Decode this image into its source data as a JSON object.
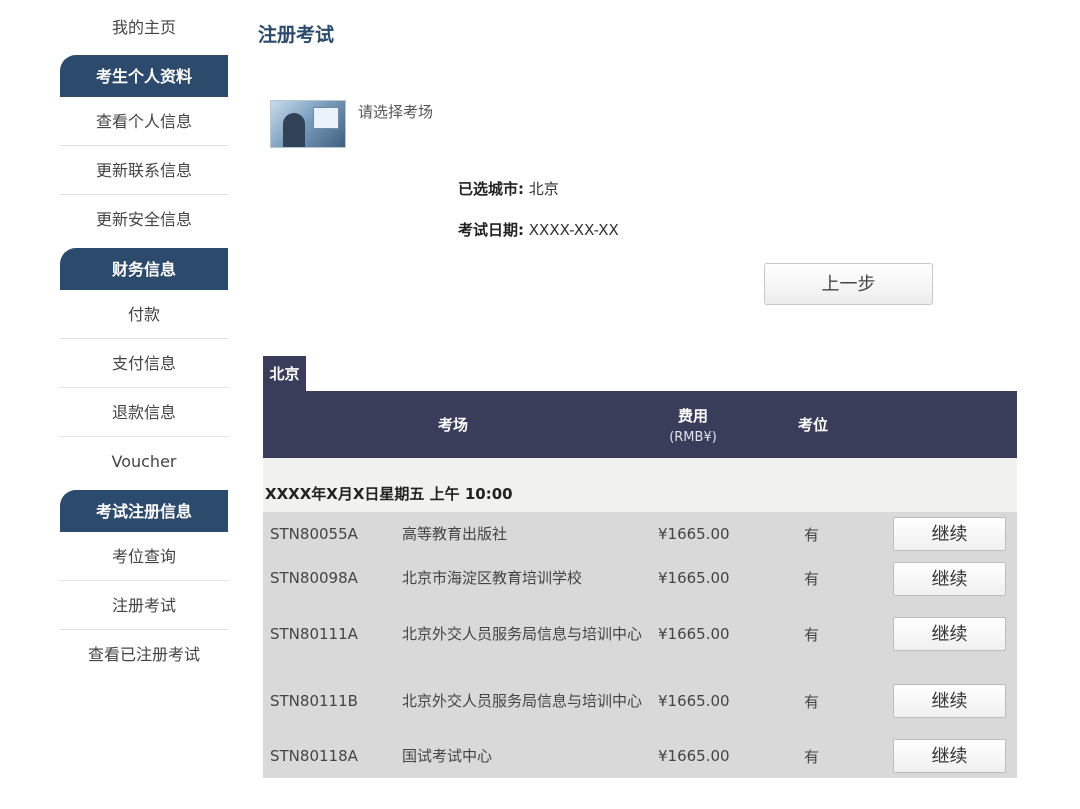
{
  "sidebar": {
    "home": "我的主页",
    "sections": [
      {
        "title": "考生个人资料",
        "items": [
          "查看个人信息",
          "更新联系信息",
          "更新安全信息"
        ]
      },
      {
        "title": "财务信息",
        "items": [
          "付款",
          "支付信息",
          "退款信息",
          "Voucher"
        ]
      },
      {
        "title": "考试注册信息",
        "items": [
          "考位查询",
          "注册考试",
          "查看已注册考试"
        ]
      }
    ]
  },
  "main": {
    "title": "注册考试",
    "select_hint": "请选择考场",
    "city_label": "已选城市:",
    "city_value": "北京",
    "date_label": "考试日期:",
    "date_value": "XXXX-XX-XX",
    "prev_button": "上一步",
    "city_tab": "北京",
    "table": {
      "headers": {
        "site": "考场",
        "fee": "费用",
        "fee_unit": "(RMB¥)",
        "seat": "考位"
      },
      "session": "XXXX年X月X日星期五 上午 10:00",
      "continue_label": "继续",
      "rows": [
        {
          "code": "STN80055A",
          "name": "高等教育出版社",
          "fee": "¥1665.00",
          "seat": "有"
        },
        {
          "code": "STN80098A",
          "name": "北京市海淀区教育培训学校",
          "fee": "¥1665.00",
          "seat": "有"
        },
        {
          "code": "STN80111A",
          "name": "北京外交人员服务局信息与培训中心",
          "fee": "¥1665.00",
          "seat": "有"
        },
        {
          "code": "STN80111B",
          "name": "北京外交人员服务局信息与培训中心",
          "fee": "¥1665.00",
          "seat": "有"
        },
        {
          "code": "STN80118A",
          "name": "国试考试中心",
          "fee": "¥1665.00",
          "seat": "有"
        }
      ]
    }
  }
}
